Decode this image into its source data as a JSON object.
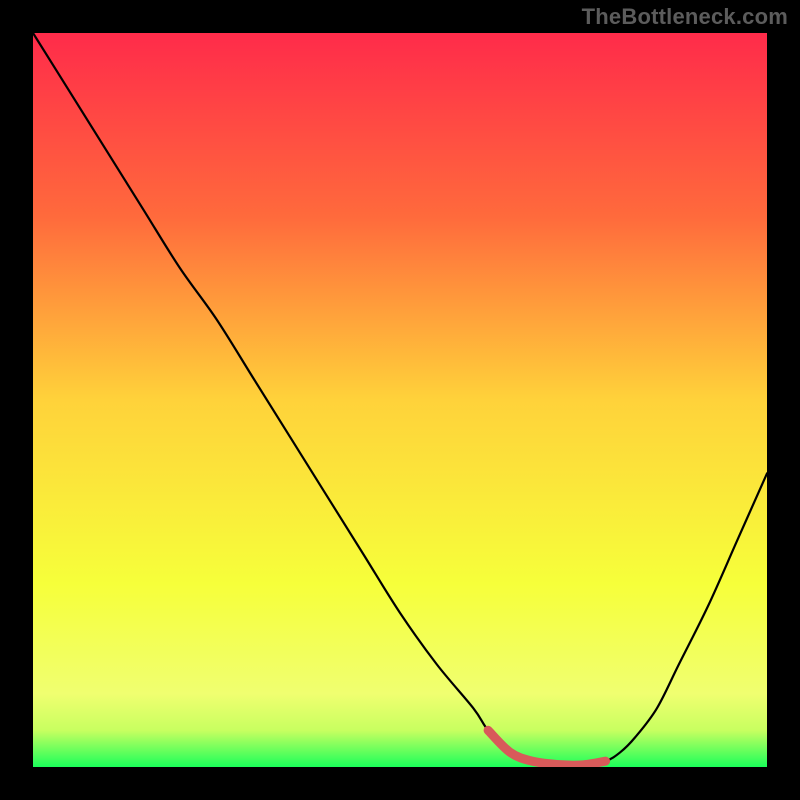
{
  "watermark": "TheBottleneck.com",
  "chart_data": {
    "type": "line",
    "title": "",
    "xlabel": "",
    "ylabel": "",
    "xlim": [
      0,
      100
    ],
    "ylim": [
      0,
      100
    ],
    "gradient_stops": [
      {
        "offset": 0,
        "color": "#ff2b4a"
      },
      {
        "offset": 25,
        "color": "#ff6a3c"
      },
      {
        "offset": 50,
        "color": "#ffd23a"
      },
      {
        "offset": 75,
        "color": "#f6ff3a"
      },
      {
        "offset": 90,
        "color": "#f0ff70"
      },
      {
        "offset": 95,
        "color": "#c8ff60"
      },
      {
        "offset": 100,
        "color": "#1bff5a"
      }
    ],
    "series": [
      {
        "name": "bottleneck-curve",
        "x": [
          0,
          5,
          10,
          15,
          20,
          25,
          30,
          35,
          40,
          45,
          50,
          55,
          60,
          62,
          65,
          68,
          72,
          75,
          78,
          80,
          82,
          85,
          88,
          92,
          96,
          100
        ],
        "y": [
          100,
          92,
          84,
          76,
          68,
          61,
          53,
          45,
          37,
          29,
          21,
          14,
          8,
          5,
          2,
          0.8,
          0.3,
          0.3,
          0.8,
          2,
          4,
          8,
          14,
          22,
          31,
          40
        ]
      }
    ],
    "highlight_segment": {
      "name": "optimal-range",
      "x": [
        62,
        65,
        68,
        72,
        75,
        78
      ],
      "y": [
        5,
        2,
        0.8,
        0.3,
        0.3,
        0.8
      ],
      "color": "#d85a5a"
    }
  }
}
